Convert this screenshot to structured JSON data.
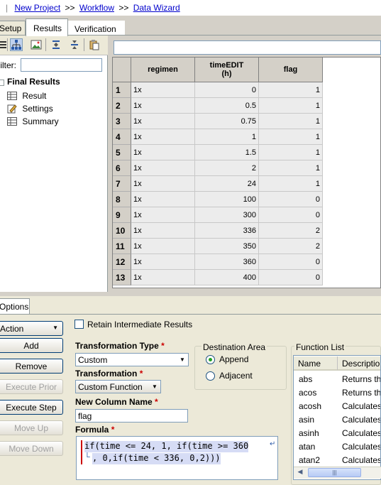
{
  "breadcrumb": {
    "items": [
      "New Project",
      "Workflow",
      "Data Wizard"
    ],
    "separator": ">>"
  },
  "top_tabs": {
    "items": [
      "Setup",
      "Results",
      "Verification"
    ],
    "active": "Results"
  },
  "filter": {
    "label": "Filter:",
    "value": ""
  },
  "tree": {
    "root": "Final Results",
    "children": [
      "Result",
      "Settings",
      "Summary"
    ]
  },
  "grid": {
    "columns": [
      {
        "title": "regimen"
      },
      {
        "title": "timeEDIT\n(h)"
      },
      {
        "title": "flag"
      }
    ],
    "rows": [
      [
        "1x",
        "0",
        "1"
      ],
      [
        "1x",
        "0.5",
        "1"
      ],
      [
        "1x",
        "0.75",
        "1"
      ],
      [
        "1x",
        "1",
        "1"
      ],
      [
        "1x",
        "1.5",
        "1"
      ],
      [
        "1x",
        "2",
        "1"
      ],
      [
        "1x",
        "24",
        "1"
      ],
      [
        "1x",
        "100",
        "0"
      ],
      [
        "1x",
        "300",
        "0"
      ],
      [
        "1x",
        "336",
        "2"
      ],
      [
        "1x",
        "350",
        "2"
      ],
      [
        "1x",
        "360",
        "0"
      ],
      [
        "1x",
        "400",
        "0"
      ]
    ]
  },
  "options_tab": "Options",
  "buttons": {
    "action": "Action",
    "add": "Add",
    "remove": "Remove",
    "execute_prior": "Execute Prior",
    "execute_step": "Execute Step",
    "move_up": "Move Up",
    "move_down": "Move Down"
  },
  "retain": {
    "label": "Retain Intermediate Results",
    "checked": false
  },
  "transformation_type": {
    "label": "Transformation Type",
    "value": "Custom"
  },
  "transformation": {
    "label": "Transformation",
    "value": "Custom Function"
  },
  "new_column_name": {
    "label": "New Column Name",
    "value": "flag"
  },
  "formula": {
    "label": "Formula",
    "line1": "if(time <= 24, 1, if(time >= 360",
    "line2": ", 0,if(time < 336, 0,2)))"
  },
  "destination_area": {
    "label": "Destination Area",
    "options": [
      "Append",
      "Adjacent"
    ],
    "selected": "Append"
  },
  "function_list": {
    "label": "Function List",
    "headers": [
      "Name",
      "Description"
    ],
    "items": [
      {
        "name": "abs",
        "desc": "Returns th"
      },
      {
        "name": "acos",
        "desc": "Returns th"
      },
      {
        "name": "acosh",
        "desc": "Calculates"
      },
      {
        "name": "asin",
        "desc": "Calculates"
      },
      {
        "name": "asinh",
        "desc": "Calculates"
      },
      {
        "name": "atan",
        "desc": "Calculates"
      },
      {
        "name": "atan2",
        "desc": "Calculates"
      }
    ]
  },
  "colors": {
    "link": "#0000cc",
    "required": "#cc0000",
    "panel": "#d4d0c8",
    "selection": "#d6dcf5"
  }
}
